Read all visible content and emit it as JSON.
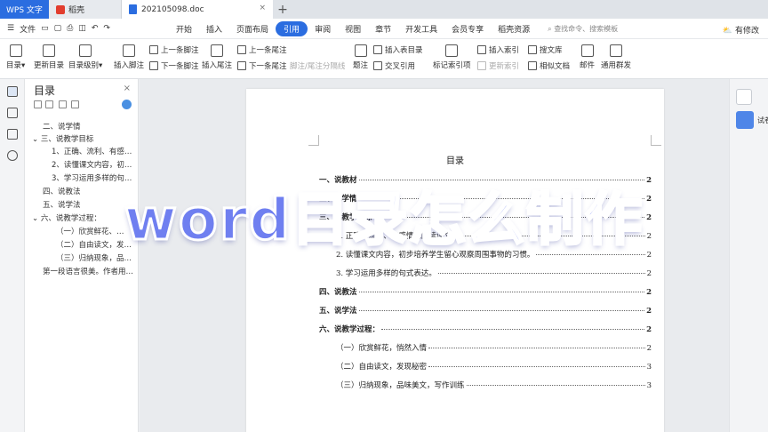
{
  "titlebar": {
    "app_tab": "WPS 文字",
    "tab2": "稻壳",
    "doc_tab": "202105098.doc",
    "close": "×",
    "plus": "+"
  },
  "menubar": {
    "file": "文件",
    "items": [
      "开始",
      "插入",
      "页面布局",
      "引用",
      "审阅",
      "视图",
      "章节",
      "开发工具",
      "会员专享",
      "稻壳资源"
    ],
    "active_item": "引用",
    "search": "查找命令、搜索模板",
    "right": "有修改"
  },
  "ribbon": {
    "toc": "目录",
    "update_toc": "更新目录",
    "toc_level": "目录级别",
    "insert_footnote": "插入脚注",
    "prev_footnote": "上一条脚注",
    "next_footnote": "下一条脚注",
    "insert_endnote": "插入尾注",
    "prev_endnote": "上一条尾注",
    "next_endnote": "下一条尾注",
    "note_separator": "脚注/尾注分隔线",
    "caption": "题注",
    "insert_toc_table": "插入表目录",
    "cross_ref": "交叉引用",
    "mark_index": "标记索引项",
    "insert_index": "插入索引",
    "update_index": "更新索引",
    "search_library": "搜文库",
    "similar_docs": "相似文档",
    "mail": "邮件",
    "mass_mail": "通用群发"
  },
  "outline": {
    "title": "目录",
    "close": "×",
    "items": [
      "二、说学情",
      "三、说教学目标",
      "1、正确、流利、有感…",
      "2、读懂课文内容，初…",
      "3、学习运用多样的句…",
      "四、说教法",
      "五、说学法",
      "六、说教学过程：",
      "（一）欣赏鲜花、…",
      "（二）自由读文，发…",
      "（三）归纳现象，品…",
      "第一段语言很美。作者用…"
    ]
  },
  "document": {
    "title": "目录",
    "toc": [
      {
        "text": "一、说教材",
        "page": "2",
        "level": 1
      },
      {
        "text": "二、说学情",
        "page": "2",
        "level": 1
      },
      {
        "text": "三、说教学目标",
        "page": "2",
        "level": 1
      },
      {
        "text": "1. 正确、流利、有感情地朗读课文。",
        "page": "2",
        "level": 2
      },
      {
        "text": "2. 读懂课文内容，初步培养学生留心观察周围事物的习惯。",
        "page": "2",
        "level": 2
      },
      {
        "text": "3. 学习运用多样的句式表达。",
        "page": "2",
        "level": 2
      },
      {
        "text": "四、说教法",
        "page": "2",
        "level": 1
      },
      {
        "text": "五、说学法",
        "page": "2",
        "level": 1
      },
      {
        "text": "六、说教学过程：",
        "page": "2",
        "level": 1
      },
      {
        "text": "（一）欣赏鲜花，悄然入情",
        "page": "2",
        "level": 3
      },
      {
        "text": "（二）自由读文，发现秘密",
        "page": "3",
        "level": 3
      },
      {
        "text": "（三）归纳现象，品味美文，写作训练",
        "page": "3",
        "level": 3
      }
    ]
  },
  "rightpanel": {
    "label": "试卷"
  },
  "overlay": {
    "text": "word目录怎么制作"
  },
  "colors": {
    "accent": "#2b6de0",
    "overlay_fill": "#6f7ff0"
  }
}
